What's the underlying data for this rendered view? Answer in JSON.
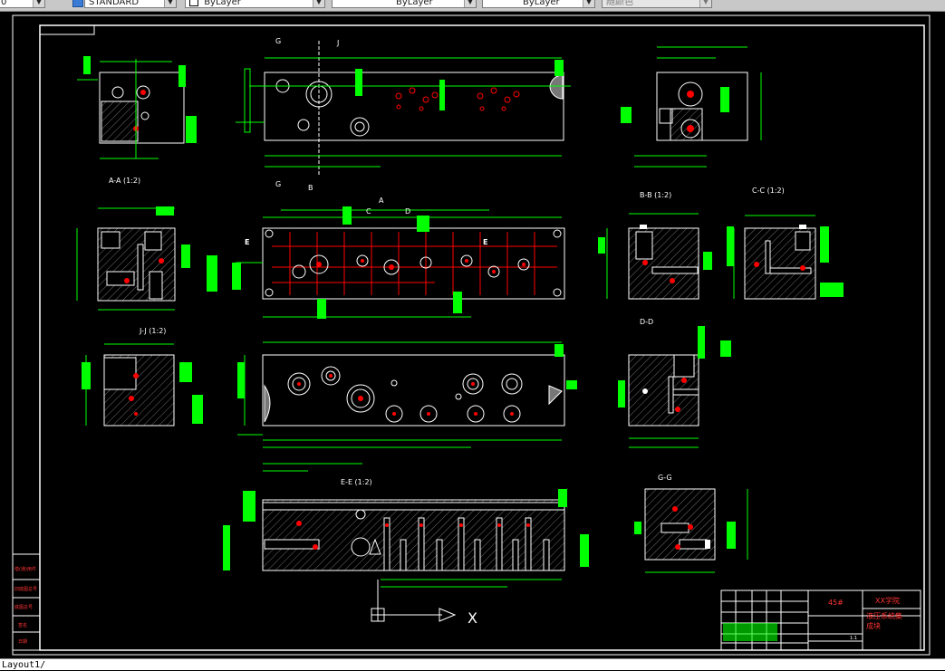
{
  "toolbar": {
    "layer_value": "0",
    "textstyle_value": "STANDARD",
    "color_value": "ByLayer",
    "linetype_value": "ByLayer",
    "lineweight_value": "ByLayer",
    "plotstyle_value": "随颜色"
  },
  "drawing": {
    "views": {
      "aa": "A-A (1:2)",
      "bb": "B-B (1:2)",
      "cc": "C-C (1:2)",
      "dd": "D-D",
      "jj": "J-J (1:2)",
      "ee": "E-E (1:2)",
      "gg": "G-G"
    },
    "markers": {
      "g_top": "G",
      "j_top": "J",
      "g_mid": "G",
      "b_mid": "B",
      "a_mid": "A",
      "c_mid": "C",
      "d_mid": "D",
      "e_left": "E",
      "e_right": "E",
      "x_axis": "X"
    },
    "title_block": {
      "material": "45#",
      "school": "XX学院",
      "name_line1": "液压系统集",
      "name_line2": "成块",
      "scale": "1:1"
    },
    "revision_labels": [
      "借(通)用件",
      "旧底图总号",
      "底图总号",
      "签名",
      "日期"
    ]
  },
  "colors": {
    "background": "#000000",
    "line": "#ffffff",
    "dimension": "#00ff00",
    "hole": "#ff0000",
    "hatch": "#808080"
  },
  "cmdline": {
    "text": "Layout1/"
  }
}
